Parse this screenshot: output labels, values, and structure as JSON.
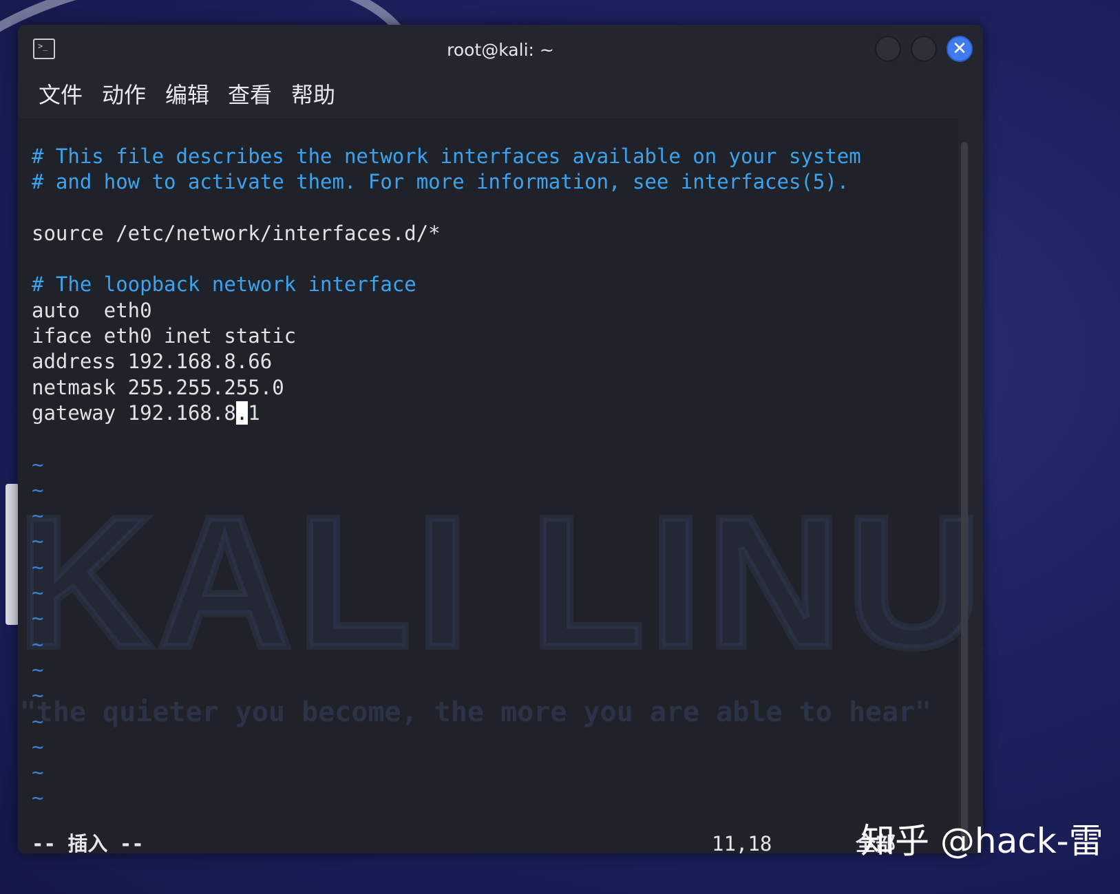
{
  "window": {
    "title": "root@kali: ~",
    "close_glyph": "✕"
  },
  "menu": [
    "文件",
    "动作",
    "编辑",
    "查看",
    "帮助"
  ],
  "editor": {
    "lines": [
      {
        "text": "# This file describes the network interfaces available on your system",
        "kind": "comment"
      },
      {
        "text": "# and how to activate them. For more information, see interfaces(5).",
        "kind": "comment"
      },
      {
        "text": "",
        "kind": "normal"
      },
      {
        "text": "source /etc/network/interfaces.d/*",
        "kind": "normal"
      },
      {
        "text": "",
        "kind": "normal"
      },
      {
        "text": "# The loopback network interface",
        "kind": "comment"
      },
      {
        "text": "auto  eth0",
        "kind": "normal"
      },
      {
        "text": "iface eth0 inet static",
        "kind": "normal"
      },
      {
        "text": "address 192.168.8.66",
        "kind": "normal"
      },
      {
        "text": "netmask 255.255.255.0",
        "kind": "normal"
      },
      {
        "text": "gateway 192.168.8.1",
        "kind": "normal",
        "cursor_col": 17
      },
      {
        "text": "",
        "kind": "normal"
      },
      {
        "text": "~",
        "kind": "tilde"
      },
      {
        "text": "~",
        "kind": "tilde"
      },
      {
        "text": "~",
        "kind": "tilde"
      },
      {
        "text": "~",
        "kind": "tilde"
      },
      {
        "text": "~",
        "kind": "tilde"
      },
      {
        "text": "~",
        "kind": "tilde"
      },
      {
        "text": "~",
        "kind": "tilde"
      },
      {
        "text": "~",
        "kind": "tilde"
      },
      {
        "text": "~",
        "kind": "tilde"
      },
      {
        "text": "~",
        "kind": "tilde"
      },
      {
        "text": "~",
        "kind": "tilde"
      },
      {
        "text": "~",
        "kind": "tilde"
      },
      {
        "text": "~",
        "kind": "tilde"
      },
      {
        "text": "~",
        "kind": "tilde"
      }
    ],
    "status_mode": "-- 插入 --",
    "status_position": "11,18",
    "status_scope": "全部"
  },
  "wallpaper": {
    "logo_text": "KALI LINUX",
    "tagline": "\"the quieter you become, the more you are able to hear\""
  },
  "credit": "知乎 @hack-雷"
}
